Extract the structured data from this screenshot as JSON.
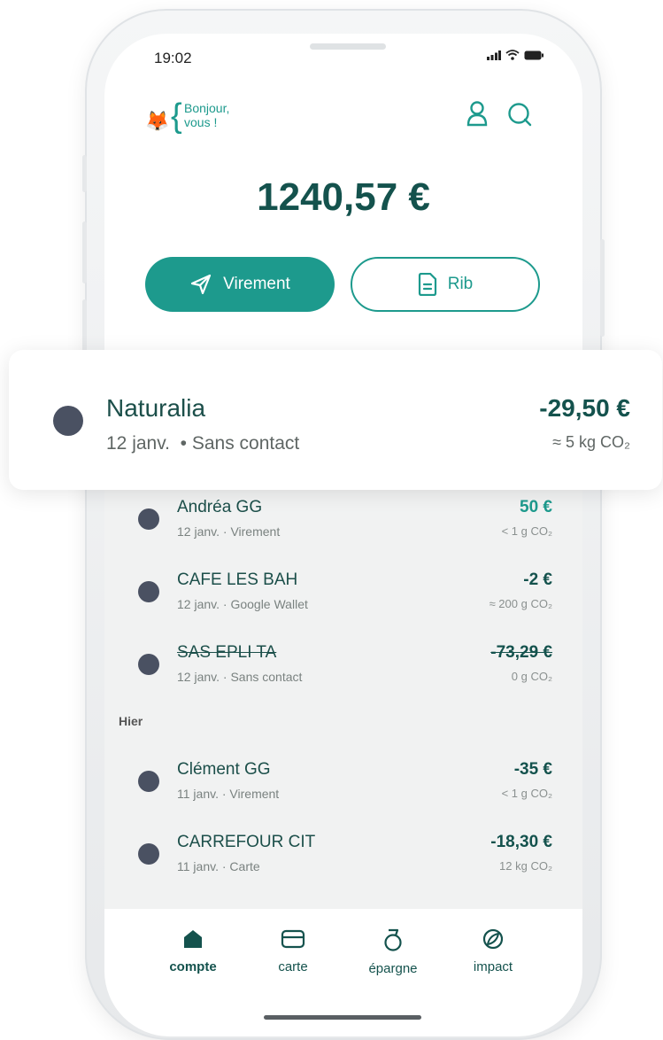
{
  "status": {
    "time": "19:02"
  },
  "header": {
    "greeting_line1": "Bonjour,",
    "greeting_line2": "vous !"
  },
  "balance": "1240,57 €",
  "actions": {
    "transfer_label": "Virement",
    "rib_label": "Rib"
  },
  "highlighted_transaction": {
    "name": "Naturalia",
    "date": "12 janv.",
    "method": "Sans contact",
    "amount": "-29,50 €",
    "co2": "≈ 5 kg CO₂"
  },
  "transactions": [
    {
      "name": "Andréa GG",
      "date": "12 janv.",
      "method": "Virement",
      "amount": "50 €",
      "co2": "< 1 g CO₂",
      "cancelled": false
    },
    {
      "name": "CAFE LES BAH",
      "date": "12 janv.",
      "method": "Google Wallet",
      "amount": "-2 €",
      "co2": "≈ 200 g CO₂",
      "cancelled": false
    },
    {
      "name": "SAS EPLI TA",
      "date": "12 janv.",
      "method": "Sans contact",
      "amount": "-73,29 €",
      "co2": "0 g CO₂",
      "cancelled": true
    }
  ],
  "section_yesterday": "Hier",
  "transactions_yesterday": [
    {
      "name": "Clément GG",
      "date": "11 janv.",
      "method": "Virement",
      "amount": "-35 €",
      "co2": "< 1 g CO₂"
    },
    {
      "name": "CARREFOUR CIT",
      "date": "11 janv.",
      "method": "Carte",
      "amount": "-18,30 €",
      "co2": "12 kg CO₂"
    }
  ],
  "tabs": [
    {
      "label": "compte",
      "icon": "home-icon",
      "active": true
    },
    {
      "label": "carte",
      "icon": "card-icon",
      "active": false
    },
    {
      "label": "épargne",
      "icon": "savings-icon",
      "active": false
    },
    {
      "label": "impact",
      "icon": "leaf-icon",
      "active": false
    }
  ],
  "colors": {
    "accent": "#1d9a8d",
    "dark_green": "#14524d",
    "dot": "#4a5162"
  }
}
